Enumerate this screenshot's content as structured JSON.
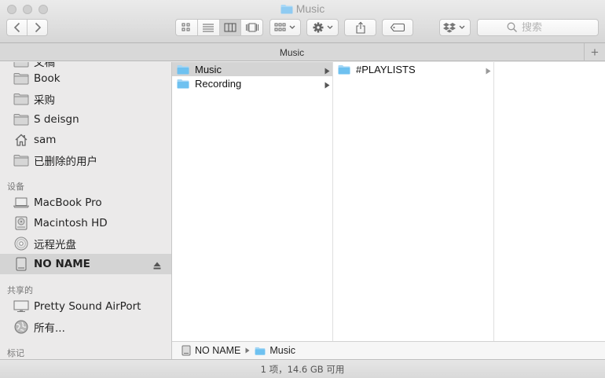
{
  "window": {
    "title": "Music"
  },
  "toolbar": {
    "search": {
      "placeholder": "搜索",
      "value": ""
    }
  },
  "tabbar": {
    "active_tab": "Music",
    "new_tab_label": "+"
  },
  "sidebar": {
    "partial_item": "文稿",
    "favorites": [
      {
        "label": "Book",
        "icon": "folder-icon"
      },
      {
        "label": "采购",
        "icon": "folder-icon"
      },
      {
        "label": "S deisgn",
        "icon": "folder-icon"
      },
      {
        "label": "sam",
        "icon": "home-icon"
      },
      {
        "label": "已删除的用户",
        "icon": "folder-icon"
      }
    ],
    "devices_header": "设备",
    "devices": [
      {
        "label": "MacBook Pro",
        "icon": "laptop-icon"
      },
      {
        "label": "Macintosh HD",
        "icon": "harddisk-icon"
      },
      {
        "label": "远程光盘",
        "icon": "optical-disc-icon"
      },
      {
        "label": "NO NAME",
        "icon": "external-drive-icon",
        "selected": true
      }
    ],
    "shared_header": "共享的",
    "shared": [
      {
        "label": "Pretty Sound AirPort",
        "icon": "display-icon"
      },
      {
        "label": "所有...",
        "icon": "network-globe-icon"
      }
    ],
    "tags_header": "标记"
  },
  "columns": [
    {
      "items": [
        {
          "label": "Music",
          "selected": true,
          "has_children": true
        },
        {
          "label": "Recording",
          "selected": false,
          "has_children": true
        }
      ]
    },
    {
      "items": [
        {
          "label": "#PLAYLISTS",
          "selected": false,
          "has_children": true
        }
      ]
    },
    {
      "items": []
    }
  ],
  "pathbar": [
    {
      "label": "NO NAME",
      "icon": "external-drive-icon"
    },
    {
      "label": "Music",
      "icon": "folder-icon"
    }
  ],
  "statusbar": {
    "text": "1 项，14.6 GB 可用"
  },
  "colors": {
    "folder_blue": "#6ec1f0",
    "selection_gray": "#d4d4d4"
  }
}
